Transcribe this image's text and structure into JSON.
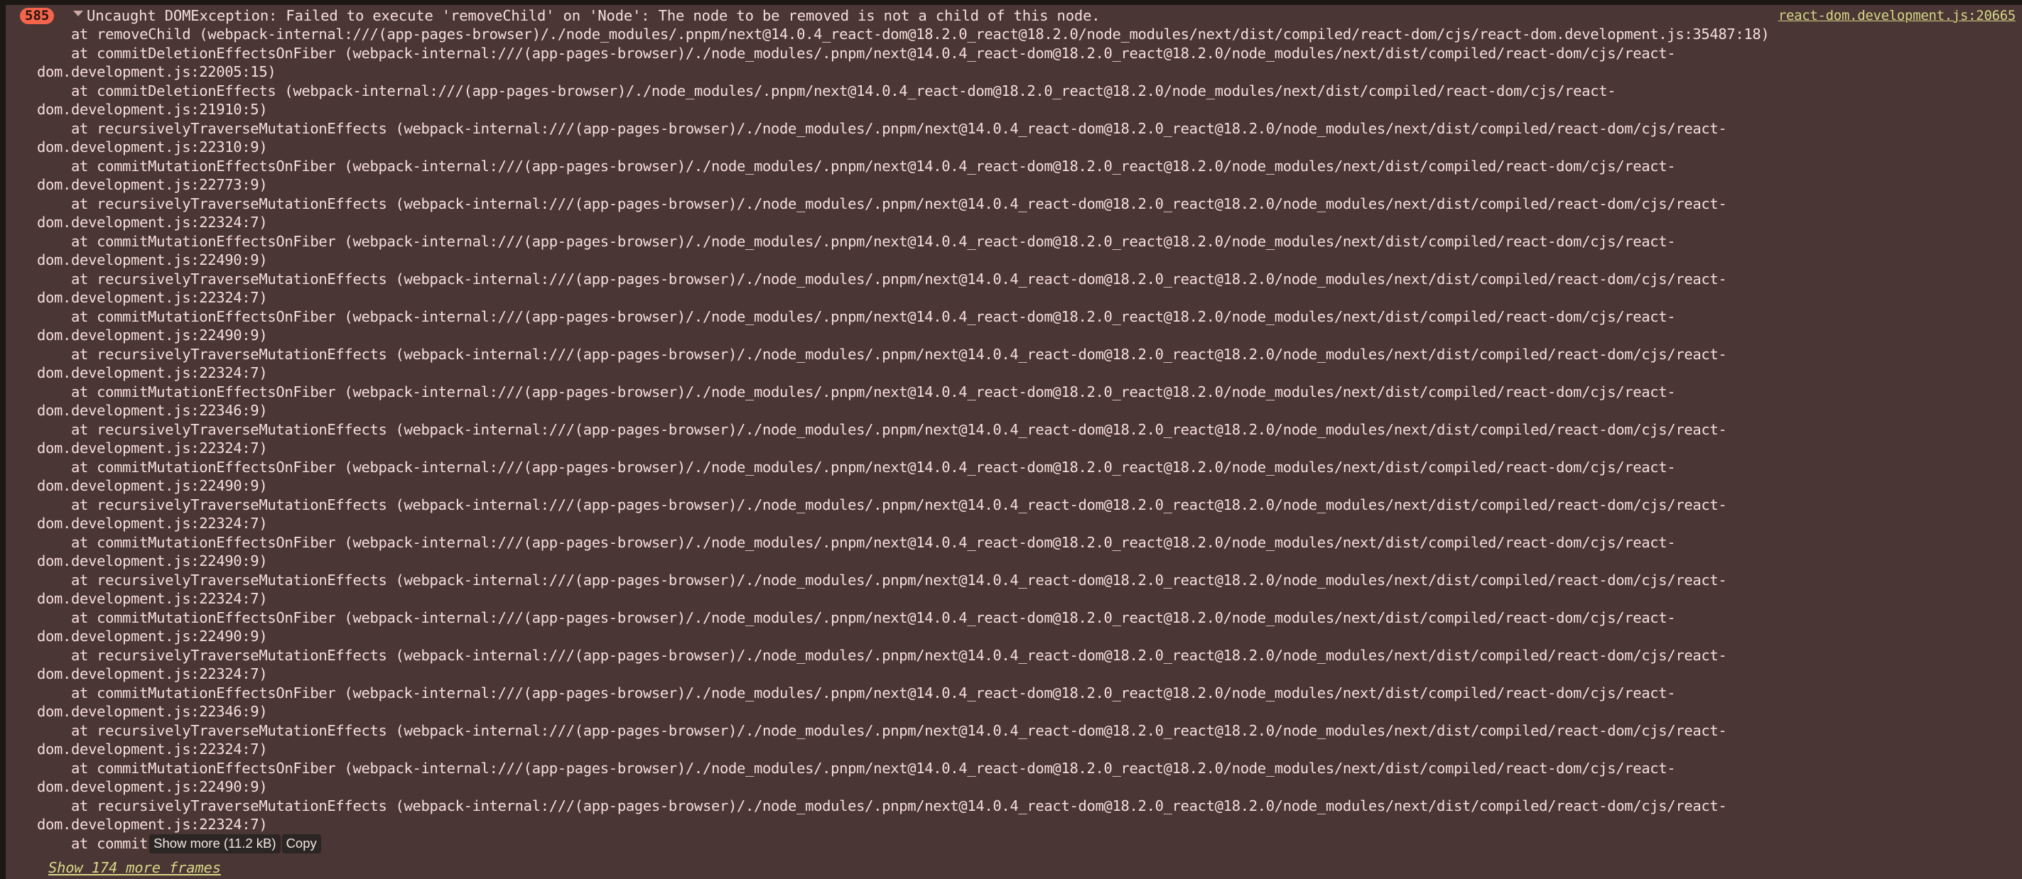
{
  "console": {
    "error_count": "585",
    "collapse_icon": "chevron-down-icon",
    "message": "Uncaught DOMException: Failed to execute 'removeChild' on 'Node': The node to be removed is not a child of this node.",
    "source_link": "react-dom.development.js:20665",
    "stack_frames": [
      "    at removeChild (webpack-internal:///(app-pages-browser)/./node_modules/.pnpm/next@14.0.4_react-dom@18.2.0_react@18.2.0/node_modules/next/dist/compiled/react-dom/cjs/react-dom.development.js:35487:18)",
      "    at commitDeletionEffectsOnFiber (webpack-internal:///(app-pages-browser)/./node_modules/.pnpm/next@14.0.4_react-dom@18.2.0_react@18.2.0/node_modules/next/dist/compiled/react-dom/cjs/react-",
      "dom.development.js:22005:15)",
      "    at commitDeletionEffects (webpack-internal:///(app-pages-browser)/./node_modules/.pnpm/next@14.0.4_react-dom@18.2.0_react@18.2.0/node_modules/next/dist/compiled/react-dom/cjs/react-",
      "dom.development.js:21910:5)",
      "    at recursivelyTraverseMutationEffects (webpack-internal:///(app-pages-browser)/./node_modules/.pnpm/next@14.0.4_react-dom@18.2.0_react@18.2.0/node_modules/next/dist/compiled/react-dom/cjs/react-",
      "dom.development.js:22310:9)",
      "    at commitMutationEffectsOnFiber (webpack-internal:///(app-pages-browser)/./node_modules/.pnpm/next@14.0.4_react-dom@18.2.0_react@18.2.0/node_modules/next/dist/compiled/react-dom/cjs/react-",
      "dom.development.js:22773:9)",
      "    at recursivelyTraverseMutationEffects (webpack-internal:///(app-pages-browser)/./node_modules/.pnpm/next@14.0.4_react-dom@18.2.0_react@18.2.0/node_modules/next/dist/compiled/react-dom/cjs/react-",
      "dom.development.js:22324:7)",
      "    at commitMutationEffectsOnFiber (webpack-internal:///(app-pages-browser)/./node_modules/.pnpm/next@14.0.4_react-dom@18.2.0_react@18.2.0/node_modules/next/dist/compiled/react-dom/cjs/react-",
      "dom.development.js:22490:9)",
      "    at recursivelyTraverseMutationEffects (webpack-internal:///(app-pages-browser)/./node_modules/.pnpm/next@14.0.4_react-dom@18.2.0_react@18.2.0/node_modules/next/dist/compiled/react-dom/cjs/react-",
      "dom.development.js:22324:7)",
      "    at commitMutationEffectsOnFiber (webpack-internal:///(app-pages-browser)/./node_modules/.pnpm/next@14.0.4_react-dom@18.2.0_react@18.2.0/node_modules/next/dist/compiled/react-dom/cjs/react-",
      "dom.development.js:22490:9)",
      "    at recursivelyTraverseMutationEffects (webpack-internal:///(app-pages-browser)/./node_modules/.pnpm/next@14.0.4_react-dom@18.2.0_react@18.2.0/node_modules/next/dist/compiled/react-dom/cjs/react-",
      "dom.development.js:22324:7)",
      "    at commitMutationEffectsOnFiber (webpack-internal:///(app-pages-browser)/./node_modules/.pnpm/next@14.0.4_react-dom@18.2.0_react@18.2.0/node_modules/next/dist/compiled/react-dom/cjs/react-",
      "dom.development.js:22346:9)",
      "    at recursivelyTraverseMutationEffects (webpack-internal:///(app-pages-browser)/./node_modules/.pnpm/next@14.0.4_react-dom@18.2.0_react@18.2.0/node_modules/next/dist/compiled/react-dom/cjs/react-",
      "dom.development.js:22324:7)",
      "    at commitMutationEffectsOnFiber (webpack-internal:///(app-pages-browser)/./node_modules/.pnpm/next@14.0.4_react-dom@18.2.0_react@18.2.0/node_modules/next/dist/compiled/react-dom/cjs/react-",
      "dom.development.js:22490:9)",
      "    at recursivelyTraverseMutationEffects (webpack-internal:///(app-pages-browser)/./node_modules/.pnpm/next@14.0.4_react-dom@18.2.0_react@18.2.0/node_modules/next/dist/compiled/react-dom/cjs/react-",
      "dom.development.js:22324:7)",
      "    at commitMutationEffectsOnFiber (webpack-internal:///(app-pages-browser)/./node_modules/.pnpm/next@14.0.4_react-dom@18.2.0_react@18.2.0/node_modules/next/dist/compiled/react-dom/cjs/react-",
      "dom.development.js:22490:9)",
      "    at recursivelyTraverseMutationEffects (webpack-internal:///(app-pages-browser)/./node_modules/.pnpm/next@14.0.4_react-dom@18.2.0_react@18.2.0/node_modules/next/dist/compiled/react-dom/cjs/react-",
      "dom.development.js:22324:7)",
      "    at commitMutationEffectsOnFiber (webpack-internal:///(app-pages-browser)/./node_modules/.pnpm/next@14.0.4_react-dom@18.2.0_react@18.2.0/node_modules/next/dist/compiled/react-dom/cjs/react-",
      "dom.development.js:22490:9)",
      "    at recursivelyTraverseMutationEffects (webpack-internal:///(app-pages-browser)/./node_modules/.pnpm/next@14.0.4_react-dom@18.2.0_react@18.2.0/node_modules/next/dist/compiled/react-dom/cjs/react-",
      "dom.development.js:22324:7)",
      "    at commitMutationEffectsOnFiber (webpack-internal:///(app-pages-browser)/./node_modules/.pnpm/next@14.0.4_react-dom@18.2.0_react@18.2.0/node_modules/next/dist/compiled/react-dom/cjs/react-",
      "dom.development.js:22346:9)",
      "    at recursivelyTraverseMutationEffects (webpack-internal:///(app-pages-browser)/./node_modules/.pnpm/next@14.0.4_react-dom@18.2.0_react@18.2.0/node_modules/next/dist/compiled/react-dom/cjs/react-",
      "dom.development.js:22324:7)",
      "    at commitMutationEffectsOnFiber (webpack-internal:///(app-pages-browser)/./node_modules/.pnpm/next@14.0.4_react-dom@18.2.0_react@18.2.0/node_modules/next/dist/compiled/react-dom/cjs/react-",
      "dom.development.js:22490:9)",
      "    at recursivelyTraverseMutationEffects (webpack-internal:///(app-pages-browser)/./node_modules/.pnpm/next@14.0.4_react-dom@18.2.0_react@18.2.0/node_modules/next/dist/compiled/react-dom/cjs/react-",
      "dom.development.js:22324:7)"
    ],
    "last_frame_prefix": "    at commit",
    "show_more_button": "Show more (11.2 kB)",
    "copy_button": "Copy",
    "show_more_frames_link": "Show 174 more frames"
  },
  "colors": {
    "panel_background": "#4a3634",
    "page_background": "#1d1714",
    "text": "#f6dddb",
    "link": "#d7d787",
    "badge_background": "#f4654b",
    "badge_text": "#2a1412",
    "button_background": "#2b2523"
  }
}
